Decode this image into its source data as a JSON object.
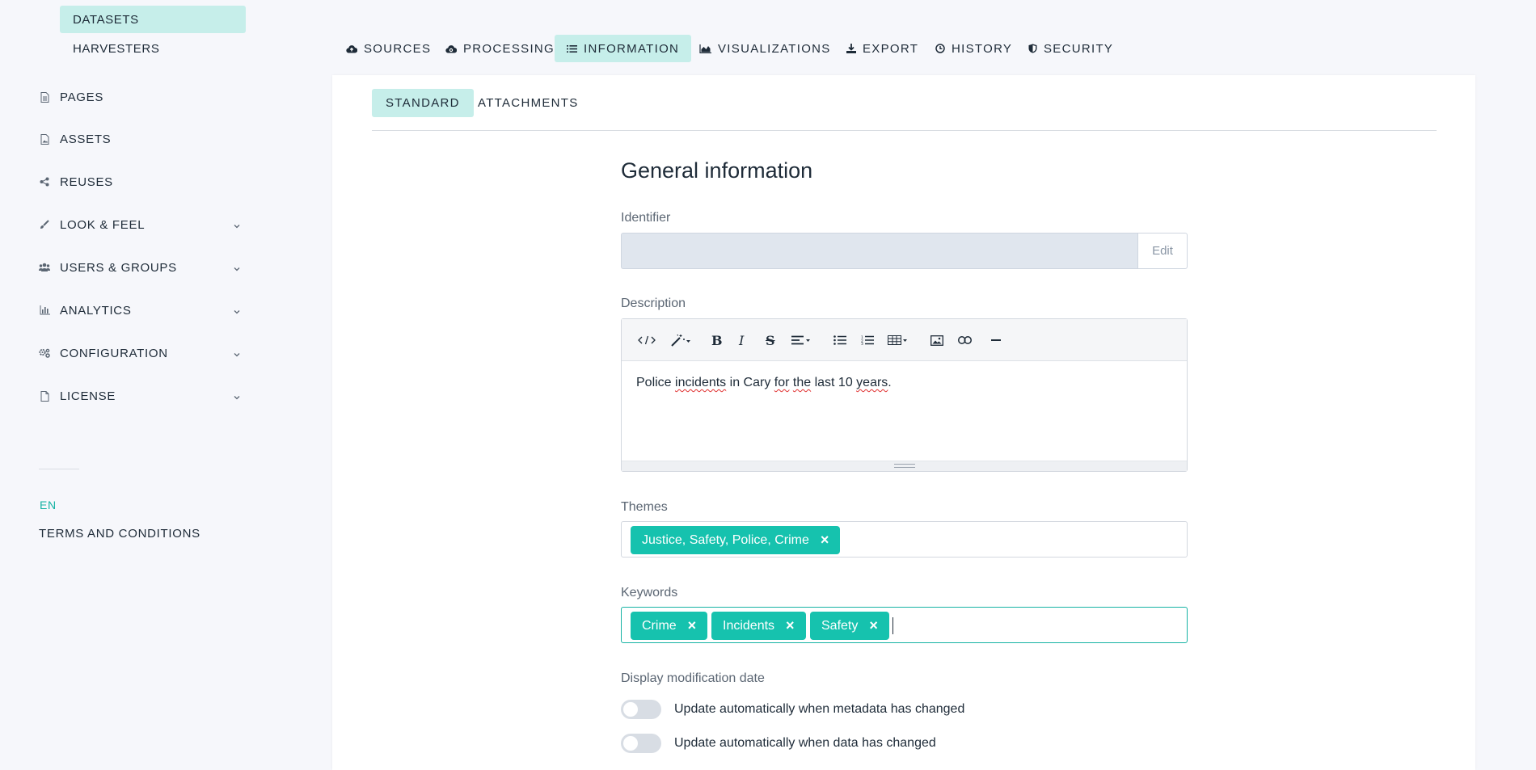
{
  "sidebar": {
    "sub_items": [
      {
        "label": "DATASETS",
        "active": true
      },
      {
        "label": "HARVESTERS",
        "active": false
      }
    ],
    "items": [
      {
        "label": "PAGES",
        "icon": "page-icon",
        "has_chevron": false
      },
      {
        "label": "ASSETS",
        "icon": "image-file-icon",
        "has_chevron": false
      },
      {
        "label": "REUSES",
        "icon": "share-icon",
        "has_chevron": false
      },
      {
        "label": "LOOK & FEEL",
        "icon": "brush-icon",
        "has_chevron": true
      },
      {
        "label": "USERS & GROUPS",
        "icon": "users-icon",
        "has_chevron": true
      },
      {
        "label": "ANALYTICS",
        "icon": "bar-chart-icon",
        "has_chevron": true
      },
      {
        "label": "CONFIGURATION",
        "icon": "gears-icon",
        "has_chevron": true
      },
      {
        "label": "LICENSE",
        "icon": "document-icon",
        "has_chevron": true
      }
    ],
    "language": "EN",
    "terms": "TERMS AND CONDITIONS"
  },
  "tabs": [
    {
      "label": "SOURCES",
      "icon": "cloud-upload-icon",
      "active": false
    },
    {
      "label": "PROCESSING",
      "icon": "cloud-gear-icon",
      "active": false
    },
    {
      "label": "INFORMATION",
      "icon": "list-icon",
      "active": true
    },
    {
      "label": "VISUALIZATIONS",
      "icon": "area-chart-icon",
      "active": false
    },
    {
      "label": "EXPORT",
      "icon": "download-icon",
      "active": false
    },
    {
      "label": "HISTORY",
      "icon": "clock-icon",
      "active": false
    },
    {
      "label": "SECURITY",
      "icon": "shield-icon",
      "active": false
    }
  ],
  "subtabs": [
    {
      "label": "STANDARD",
      "active": true
    },
    {
      "label": "ATTACHMENTS",
      "active": false
    }
  ],
  "form": {
    "title": "General information",
    "identifier_label": "Identifier",
    "identifier_value": "",
    "edit_label": "Edit",
    "description_label": "Description",
    "description_parts": [
      "Police ",
      "incidents",
      " in Cary ",
      "for",
      " ",
      "the",
      " last 10 ",
      "years",
      "."
    ],
    "themes_label": "Themes",
    "themes": [
      "Justice, Safety, Police, Crime"
    ],
    "keywords_label": "Keywords",
    "keywords": [
      "Crime",
      "Incidents",
      "Safety"
    ],
    "modification_label": "Display modification date",
    "toggle_metadata": "Update automatically when metadata has changed",
    "toggle_data": "Update automatically when data has changed"
  },
  "colors": {
    "accent": "#16c2ae",
    "active_tab_bg": "#c6eeea",
    "page_bg": "#f6f7fb"
  }
}
